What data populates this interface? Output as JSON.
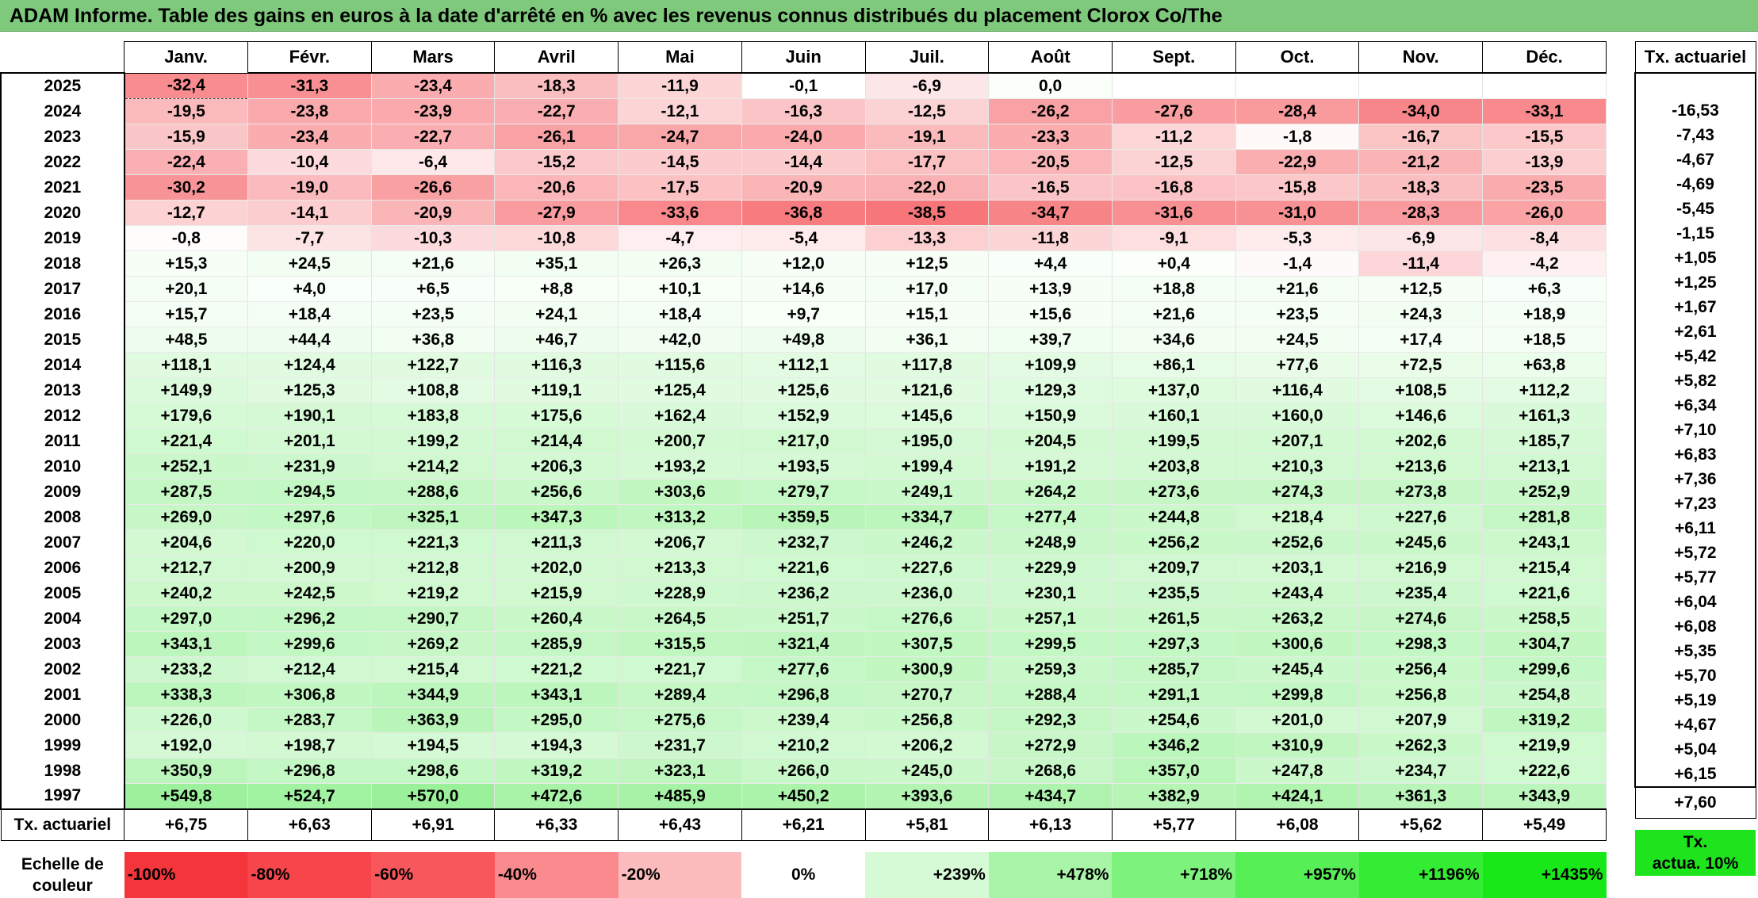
{
  "title": "ADAM Informe. Table des gains en euros à la date d'arrêté en % avec les revenus connus distribués du placement Clorox Co/The",
  "months": [
    "Janv.",
    "Févr.",
    "Mars",
    "Avril",
    "Mai",
    "Juin",
    "Juil.",
    "Août",
    "Sept.",
    "Oct.",
    "Nov.",
    "Déc."
  ],
  "side_header": "Tx. actuariel",
  "rows": [
    {
      "year": "2025",
      "values": [
        "-32,4",
        "-31,3",
        "-23,4",
        "-18,3",
        "-11,9",
        "-0,1",
        "-6,9",
        "0,0",
        "",
        "",
        "",
        ""
      ],
      "rate": ""
    },
    {
      "year": "2024",
      "values": [
        "-19,5",
        "-23,8",
        "-23,9",
        "-22,7",
        "-12,1",
        "-16,3",
        "-12,5",
        "-26,2",
        "-27,6",
        "-28,4",
        "-34,0",
        "-33,1"
      ],
      "rate": "-16,53"
    },
    {
      "year": "2023",
      "values": [
        "-15,9",
        "-23,4",
        "-22,7",
        "-26,1",
        "-24,7",
        "-24,0",
        "-19,1",
        "-23,3",
        "-11,2",
        "-1,8",
        "-16,7",
        "-15,5"
      ],
      "rate": "-7,43"
    },
    {
      "year": "2022",
      "values": [
        "-22,4",
        "-10,4",
        "-6,4",
        "-15,2",
        "-14,5",
        "-14,4",
        "-17,7",
        "-20,5",
        "-12,5",
        "-22,9",
        "-21,2",
        "-13,9"
      ],
      "rate": "-4,67"
    },
    {
      "year": "2021",
      "values": [
        "-30,2",
        "-19,0",
        "-26,6",
        "-20,6",
        "-17,5",
        "-20,9",
        "-22,0",
        "-16,5",
        "-16,8",
        "-15,8",
        "-18,3",
        "-23,5"
      ],
      "rate": "-4,69"
    },
    {
      "year": "2020",
      "values": [
        "-12,7",
        "-14,1",
        "-20,9",
        "-27,9",
        "-33,6",
        "-36,8",
        "-38,5",
        "-34,7",
        "-31,6",
        "-31,0",
        "-28,3",
        "-26,0"
      ],
      "rate": "-5,45"
    },
    {
      "year": "2019",
      "values": [
        "-0,8",
        "-7,7",
        "-10,3",
        "-10,8",
        "-4,7",
        "-5,4",
        "-13,3",
        "-11,8",
        "-9,1",
        "-5,3",
        "-6,9",
        "-8,4"
      ],
      "rate": "-1,15"
    },
    {
      "year": "2018",
      "values": [
        "+15,3",
        "+24,5",
        "+21,6",
        "+35,1",
        "+26,3",
        "+12,0",
        "+12,5",
        "+4,4",
        "+0,4",
        "-1,4",
        "-11,4",
        "-4,2"
      ],
      "rate": "+1,05"
    },
    {
      "year": "2017",
      "values": [
        "+20,1",
        "+4,0",
        "+6,5",
        "+8,8",
        "+10,1",
        "+14,6",
        "+17,0",
        "+13,9",
        "+18,8",
        "+21,6",
        "+12,5",
        "+6,3"
      ],
      "rate": "+1,25"
    },
    {
      "year": "2016",
      "values": [
        "+15,7",
        "+18,4",
        "+23,5",
        "+24,1",
        "+18,4",
        "+9,7",
        "+15,1",
        "+15,6",
        "+21,6",
        "+23,5",
        "+24,3",
        "+18,9"
      ],
      "rate": "+1,67"
    },
    {
      "year": "2015",
      "values": [
        "+48,5",
        "+44,4",
        "+36,8",
        "+46,7",
        "+42,0",
        "+49,8",
        "+36,1",
        "+39,7",
        "+34,6",
        "+24,5",
        "+17,4",
        "+18,5"
      ],
      "rate": "+2,61"
    },
    {
      "year": "2014",
      "values": [
        "+118,1",
        "+124,4",
        "+122,7",
        "+116,3",
        "+115,6",
        "+112,1",
        "+117,8",
        "+109,9",
        "+86,1",
        "+77,6",
        "+72,5",
        "+63,8"
      ],
      "rate": "+5,42"
    },
    {
      "year": "2013",
      "values": [
        "+149,9",
        "+125,3",
        "+108,8",
        "+119,1",
        "+125,4",
        "+125,6",
        "+121,6",
        "+129,3",
        "+137,0",
        "+116,4",
        "+108,5",
        "+112,2"
      ],
      "rate": "+5,82"
    },
    {
      "year": "2012",
      "values": [
        "+179,6",
        "+190,1",
        "+183,8",
        "+175,6",
        "+162,4",
        "+152,9",
        "+145,6",
        "+150,9",
        "+160,1",
        "+160,0",
        "+146,6",
        "+161,3"
      ],
      "rate": "+6,34"
    },
    {
      "year": "2011",
      "values": [
        "+221,4",
        "+201,1",
        "+199,2",
        "+214,4",
        "+200,7",
        "+217,0",
        "+195,0",
        "+204,5",
        "+199,5",
        "+207,1",
        "+202,6",
        "+185,7"
      ],
      "rate": "+7,10"
    },
    {
      "year": "2010",
      "values": [
        "+252,1",
        "+231,9",
        "+214,2",
        "+206,3",
        "+193,2",
        "+193,5",
        "+199,4",
        "+191,2",
        "+203,8",
        "+210,3",
        "+213,6",
        "+213,1"
      ],
      "rate": "+6,83"
    },
    {
      "year": "2009",
      "values": [
        "+287,5",
        "+294,5",
        "+288,6",
        "+256,6",
        "+303,6",
        "+279,7",
        "+249,1",
        "+264,2",
        "+273,6",
        "+274,3",
        "+273,8",
        "+252,9"
      ],
      "rate": "+7,36"
    },
    {
      "year": "2008",
      "values": [
        "+269,0",
        "+297,6",
        "+325,1",
        "+347,3",
        "+313,2",
        "+359,5",
        "+334,7",
        "+277,4",
        "+244,8",
        "+218,4",
        "+227,6",
        "+281,8"
      ],
      "rate": "+7,23"
    },
    {
      "year": "2007",
      "values": [
        "+204,6",
        "+220,0",
        "+221,3",
        "+211,3",
        "+206,7",
        "+232,7",
        "+246,2",
        "+248,9",
        "+256,2",
        "+252,6",
        "+245,6",
        "+243,1"
      ],
      "rate": "+6,11"
    },
    {
      "year": "2006",
      "values": [
        "+212,7",
        "+200,9",
        "+212,8",
        "+202,0",
        "+213,3",
        "+221,6",
        "+227,6",
        "+229,9",
        "+209,7",
        "+203,1",
        "+216,9",
        "+215,4"
      ],
      "rate": "+5,72"
    },
    {
      "year": "2005",
      "values": [
        "+240,2",
        "+242,5",
        "+219,2",
        "+215,9",
        "+228,9",
        "+236,2",
        "+236,0",
        "+230,1",
        "+235,5",
        "+243,4",
        "+235,4",
        "+221,6"
      ],
      "rate": "+5,77"
    },
    {
      "year": "2004",
      "values": [
        "+297,0",
        "+296,2",
        "+290,7",
        "+260,4",
        "+264,5",
        "+251,7",
        "+276,6",
        "+257,1",
        "+261,5",
        "+263,2",
        "+274,6",
        "+258,5"
      ],
      "rate": "+6,04"
    },
    {
      "year": "2003",
      "values": [
        "+343,1",
        "+299,6",
        "+269,2",
        "+285,9",
        "+315,5",
        "+321,4",
        "+307,5",
        "+299,5",
        "+297,3",
        "+300,6",
        "+298,3",
        "+304,7"
      ],
      "rate": "+6,08"
    },
    {
      "year": "2002",
      "values": [
        "+233,2",
        "+212,4",
        "+215,4",
        "+221,2",
        "+221,7",
        "+277,6",
        "+300,9",
        "+259,3",
        "+285,7",
        "+245,4",
        "+256,4",
        "+299,6"
      ],
      "rate": "+5,35"
    },
    {
      "year": "2001",
      "values": [
        "+338,3",
        "+306,8",
        "+344,9",
        "+343,1",
        "+289,4",
        "+296,8",
        "+270,7",
        "+288,4",
        "+291,1",
        "+299,8",
        "+256,8",
        "+254,8"
      ],
      "rate": "+5,70"
    },
    {
      "year": "2000",
      "values": [
        "+226,0",
        "+283,7",
        "+363,9",
        "+295,0",
        "+275,6",
        "+239,4",
        "+256,8",
        "+292,3",
        "+254,6",
        "+201,0",
        "+207,9",
        "+319,2"
      ],
      "rate": "+5,19"
    },
    {
      "year": "1999",
      "values": [
        "+192,0",
        "+198,7",
        "+194,5",
        "+194,3",
        "+231,7",
        "+210,2",
        "+206,2",
        "+272,9",
        "+346,2",
        "+310,9",
        "+262,3",
        "+219,9"
      ],
      "rate": "+4,67"
    },
    {
      "year": "1998",
      "values": [
        "+350,9",
        "+296,8",
        "+298,6",
        "+319,2",
        "+323,1",
        "+266,0",
        "+245,0",
        "+268,6",
        "+357,0",
        "+247,8",
        "+234,7",
        "+222,6"
      ],
      "rate": "+5,04"
    },
    {
      "year": "1997",
      "values": [
        "+549,8",
        "+524,7",
        "+570,0",
        "+472,6",
        "+485,9",
        "+450,2",
        "+393,6",
        "+434,7",
        "+382,9",
        "+424,1",
        "+361,3",
        "+343,9"
      ],
      "rate": "+6,15"
    }
  ],
  "totals": {
    "label": "Tx. actuariel",
    "values": [
      "+6,75",
      "+6,63",
      "+6,91",
      "+6,33",
      "+6,43",
      "+6,21",
      "+5,81",
      "+6,13",
      "+5,77",
      "+6,08",
      "+5,62",
      "+5,49"
    ],
    "overall": "+7,60"
  },
  "scale": {
    "label_line1": "Echelle de",
    "label_line2": "couleur",
    "items": [
      {
        "text": "-100%",
        "color": "#f4353b",
        "align": "left"
      },
      {
        "text": "-80%",
        "color": "#f6454b",
        "align": "left"
      },
      {
        "text": "-60%",
        "color": "#f8575c",
        "align": "left"
      },
      {
        "text": "-40%",
        "color": "#fa8a8e",
        "align": "left"
      },
      {
        "text": "-20%",
        "color": "#fcbcbe",
        "align": "left"
      },
      {
        "text": "0%",
        "color": "#ffffff",
        "align": "center"
      },
      {
        "text": "+239%",
        "color": "#d6fad6",
        "align": "right"
      },
      {
        "text": "+478%",
        "color": "#a8f5a8",
        "align": "right"
      },
      {
        "text": "+718%",
        "color": "#7df27d",
        "align": "right"
      },
      {
        "text": "+957%",
        "color": "#56ef56",
        "align": "right"
      },
      {
        "text": "+1196%",
        "color": "#33ec33",
        "align": "right"
      },
      {
        "text": "+1435%",
        "color": "#18e818",
        "align": "right"
      }
    ],
    "side_line1": "Tx.",
    "side_line2": "actua. 10%",
    "side_color": "#1ee41e"
  }
}
